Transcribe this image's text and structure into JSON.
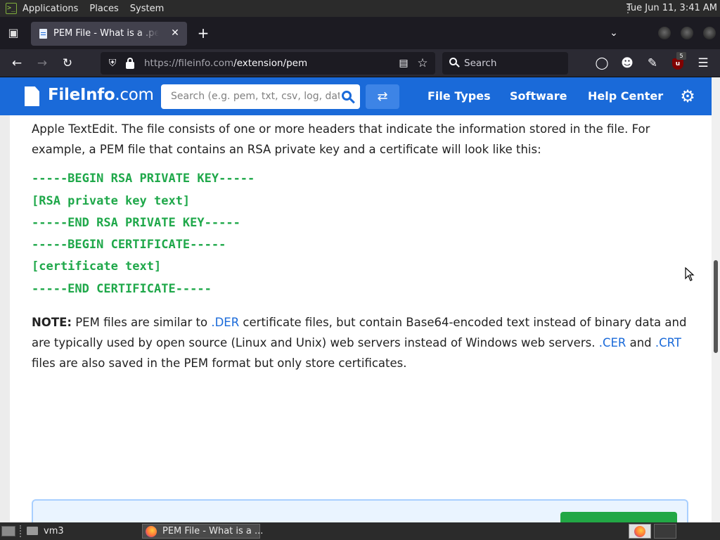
{
  "system_panel": {
    "menus": [
      "Applications",
      "Places",
      "System"
    ],
    "clock": "Tue Jun 11,  3:41 AM"
  },
  "browser": {
    "active_tab_title": "PEM File - What is a .pem file and how do I open it?",
    "url_host": "https://fileinfo.com",
    "url_path": "/extension/pem",
    "search_placeholder": "Search",
    "extension_badge": "5"
  },
  "site": {
    "logo_bold": "FileInfo",
    "logo_suffix": ".com",
    "search_placeholder": "Search (e.g. pem, txt, csv, log, dat",
    "nav": [
      "File Types",
      "Software",
      "Help Center"
    ],
    "accent_color": "#1a6ad9"
  },
  "article": {
    "intro": "Apple TextEdit. The file consists of one or more headers that indicate the information stored in the file. For example, a PEM file that contains an RSA private key and a certificate will look like this:",
    "code_lines": [
      "-----BEGIN RSA PRIVATE KEY-----",
      "[RSA private key text]",
      "-----END RSA PRIVATE KEY-----",
      "-----BEGIN CERTIFICATE-----",
      "[certificate text]",
      "-----END CERTIFICATE-----"
    ],
    "code_color": "#1fa84a",
    "note": {
      "label": "NOTE:",
      "t1": " PEM files are similar to ",
      "link_der": ".DER",
      "t2": " certificate files, but contain Base64-encoded text instead of binary data and are typically used by open source (Linux and Unix) web servers instead of Windows web servers. ",
      "link_cer": ".CER",
      "t3": " and ",
      "link_crt": ".CRT",
      "t4": " files are also saved in the PEM format but only store certificates."
    }
  },
  "taskbar": {
    "workspace_label": "vm3",
    "task_title": "PEM File - What is a ..."
  }
}
